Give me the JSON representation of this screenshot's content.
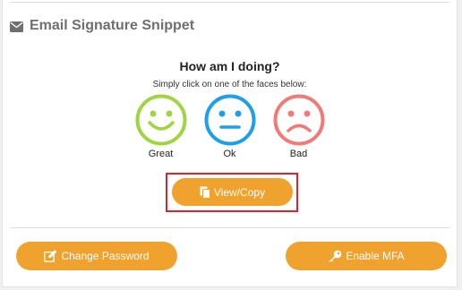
{
  "section": {
    "title": "Email Signature Snippet",
    "icon": "envelope-icon"
  },
  "rating": {
    "title": "How am I doing?",
    "subtitle": "Simply click on one of the faces below:",
    "faces": [
      {
        "label": "Great",
        "icon": "smiley-happy-icon",
        "color": "#9fd442"
      },
      {
        "label": "Ok",
        "icon": "smiley-neutral-icon",
        "color": "#1e9fe6"
      },
      {
        "label": "Bad",
        "icon": "smiley-sad-icon",
        "color": "#f07a76"
      }
    ]
  },
  "buttons": {
    "view_copy": "View/Copy",
    "change_password": "Change Password",
    "enable_mfa": "Enable MFA"
  },
  "colors": {
    "accent": "#f0a22e",
    "highlight": "#d8262f"
  }
}
